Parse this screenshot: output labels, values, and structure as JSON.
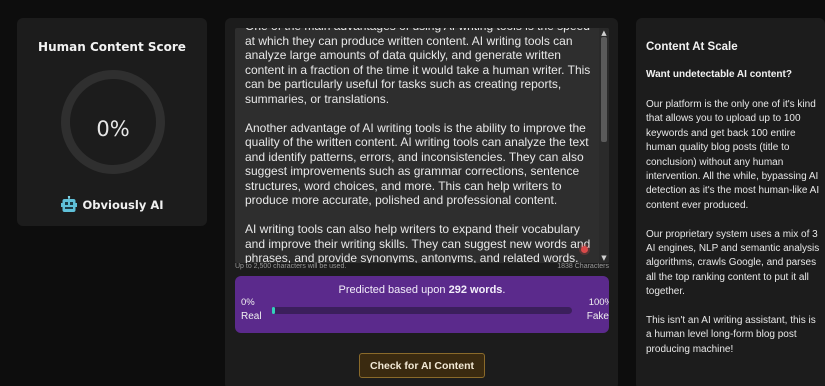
{
  "score_panel": {
    "title": "Human Content Score",
    "score": "0%",
    "verdict": "Obviously AI",
    "verdict_icon": "robot-icon"
  },
  "editor": {
    "paragraphs": [
      "One of the main advantages of using AI writing tools is the speed at which they can produce written content. AI writing tools can analyze large amounts of data quickly, and generate written content in a fraction of the time it would take a human writer. This can be particularly useful for tasks such as creating reports, summaries, or translations.",
      "Another advantage of AI writing tools is the ability to improve the quality of the written content. AI writing tools can analyze the text and identify patterns, errors, and inconsistencies. They can also suggest improvements such as grammar corrections, sentence structures, word choices, and more. This can help writers to produce more accurate, polished and professional content.",
      "AI writing tools can also help writers to expand their vocabulary and improve their writing skills. They can suggest new words and phrases, and provide synonyms, antonyms, and related words. This can help writers to express their ideas more effectively, and to create more"
    ],
    "char_limit_note": "Up to 2,500 characters will be used.",
    "char_count": "1838 Characters"
  },
  "prediction": {
    "prefix": "Predicted based upon ",
    "words": "292 words",
    "suffix": ".",
    "left_pct": "0%",
    "right_pct": "100%",
    "left_label": "Real",
    "right_label": "Fake",
    "fake_fraction": 0.0
  },
  "check_button": {
    "label": "Check for AI Content"
  },
  "right_panel": {
    "title": "Content At Scale",
    "subtitle": "Want undetectable AI content?",
    "paragraphs": [
      "Our platform is the only one of it's kind that allows you to upload up to 100 keywords and get back 100 entire human quality blog posts (title to conclusion) without any human intervention. All the while, bypassing AI detection as it's the most human-like AI content ever produced.",
      "Our proprietary system uses a mix of 3 AI engines, NLP and semantic analysis algorithms, crawls Google, and parses all the top ranking content to put it all together.",
      "This isn't an AI writing assistant, this is a human level long-form blog post producing machine!"
    ]
  },
  "colors": {
    "accent_purple": "#5b2a8c",
    "bar_teal": "#33d1bb",
    "button_gold": "#8a6a2a"
  }
}
